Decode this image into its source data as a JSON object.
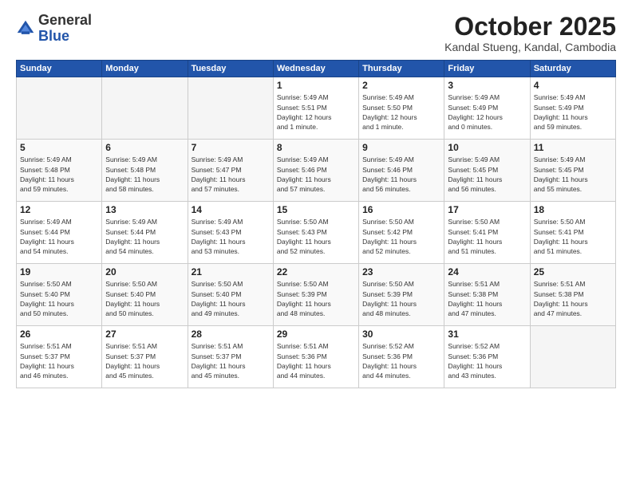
{
  "header": {
    "logo_general": "General",
    "logo_blue": "Blue",
    "month_title": "October 2025",
    "location": "Kandal Stueng, Kandal, Cambodia"
  },
  "weekdays": [
    "Sunday",
    "Monday",
    "Tuesday",
    "Wednesday",
    "Thursday",
    "Friday",
    "Saturday"
  ],
  "weeks": [
    [
      {
        "day": "",
        "info": ""
      },
      {
        "day": "",
        "info": ""
      },
      {
        "day": "",
        "info": ""
      },
      {
        "day": "1",
        "info": "Sunrise: 5:49 AM\nSunset: 5:51 PM\nDaylight: 12 hours\nand 1 minute."
      },
      {
        "day": "2",
        "info": "Sunrise: 5:49 AM\nSunset: 5:50 PM\nDaylight: 12 hours\nand 1 minute."
      },
      {
        "day": "3",
        "info": "Sunrise: 5:49 AM\nSunset: 5:49 PM\nDaylight: 12 hours\nand 0 minutes."
      },
      {
        "day": "4",
        "info": "Sunrise: 5:49 AM\nSunset: 5:49 PM\nDaylight: 11 hours\nand 59 minutes."
      }
    ],
    [
      {
        "day": "5",
        "info": "Sunrise: 5:49 AM\nSunset: 5:48 PM\nDaylight: 11 hours\nand 59 minutes."
      },
      {
        "day": "6",
        "info": "Sunrise: 5:49 AM\nSunset: 5:48 PM\nDaylight: 11 hours\nand 58 minutes."
      },
      {
        "day": "7",
        "info": "Sunrise: 5:49 AM\nSunset: 5:47 PM\nDaylight: 11 hours\nand 57 minutes."
      },
      {
        "day": "8",
        "info": "Sunrise: 5:49 AM\nSunset: 5:46 PM\nDaylight: 11 hours\nand 57 minutes."
      },
      {
        "day": "9",
        "info": "Sunrise: 5:49 AM\nSunset: 5:46 PM\nDaylight: 11 hours\nand 56 minutes."
      },
      {
        "day": "10",
        "info": "Sunrise: 5:49 AM\nSunset: 5:45 PM\nDaylight: 11 hours\nand 56 minutes."
      },
      {
        "day": "11",
        "info": "Sunrise: 5:49 AM\nSunset: 5:45 PM\nDaylight: 11 hours\nand 55 minutes."
      }
    ],
    [
      {
        "day": "12",
        "info": "Sunrise: 5:49 AM\nSunset: 5:44 PM\nDaylight: 11 hours\nand 54 minutes."
      },
      {
        "day": "13",
        "info": "Sunrise: 5:49 AM\nSunset: 5:44 PM\nDaylight: 11 hours\nand 54 minutes."
      },
      {
        "day": "14",
        "info": "Sunrise: 5:49 AM\nSunset: 5:43 PM\nDaylight: 11 hours\nand 53 minutes."
      },
      {
        "day": "15",
        "info": "Sunrise: 5:50 AM\nSunset: 5:43 PM\nDaylight: 11 hours\nand 52 minutes."
      },
      {
        "day": "16",
        "info": "Sunrise: 5:50 AM\nSunset: 5:42 PM\nDaylight: 11 hours\nand 52 minutes."
      },
      {
        "day": "17",
        "info": "Sunrise: 5:50 AM\nSunset: 5:41 PM\nDaylight: 11 hours\nand 51 minutes."
      },
      {
        "day": "18",
        "info": "Sunrise: 5:50 AM\nSunset: 5:41 PM\nDaylight: 11 hours\nand 51 minutes."
      }
    ],
    [
      {
        "day": "19",
        "info": "Sunrise: 5:50 AM\nSunset: 5:40 PM\nDaylight: 11 hours\nand 50 minutes."
      },
      {
        "day": "20",
        "info": "Sunrise: 5:50 AM\nSunset: 5:40 PM\nDaylight: 11 hours\nand 50 minutes."
      },
      {
        "day": "21",
        "info": "Sunrise: 5:50 AM\nSunset: 5:40 PM\nDaylight: 11 hours\nand 49 minutes."
      },
      {
        "day": "22",
        "info": "Sunrise: 5:50 AM\nSunset: 5:39 PM\nDaylight: 11 hours\nand 48 minutes."
      },
      {
        "day": "23",
        "info": "Sunrise: 5:50 AM\nSunset: 5:39 PM\nDaylight: 11 hours\nand 48 minutes."
      },
      {
        "day": "24",
        "info": "Sunrise: 5:51 AM\nSunset: 5:38 PM\nDaylight: 11 hours\nand 47 minutes."
      },
      {
        "day": "25",
        "info": "Sunrise: 5:51 AM\nSunset: 5:38 PM\nDaylight: 11 hours\nand 47 minutes."
      }
    ],
    [
      {
        "day": "26",
        "info": "Sunrise: 5:51 AM\nSunset: 5:37 PM\nDaylight: 11 hours\nand 46 minutes."
      },
      {
        "day": "27",
        "info": "Sunrise: 5:51 AM\nSunset: 5:37 PM\nDaylight: 11 hours\nand 45 minutes."
      },
      {
        "day": "28",
        "info": "Sunrise: 5:51 AM\nSunset: 5:37 PM\nDaylight: 11 hours\nand 45 minutes."
      },
      {
        "day": "29",
        "info": "Sunrise: 5:51 AM\nSunset: 5:36 PM\nDaylight: 11 hours\nand 44 minutes."
      },
      {
        "day": "30",
        "info": "Sunrise: 5:52 AM\nSunset: 5:36 PM\nDaylight: 11 hours\nand 44 minutes."
      },
      {
        "day": "31",
        "info": "Sunrise: 5:52 AM\nSunset: 5:36 PM\nDaylight: 11 hours\nand 43 minutes."
      },
      {
        "day": "",
        "info": ""
      }
    ]
  ]
}
